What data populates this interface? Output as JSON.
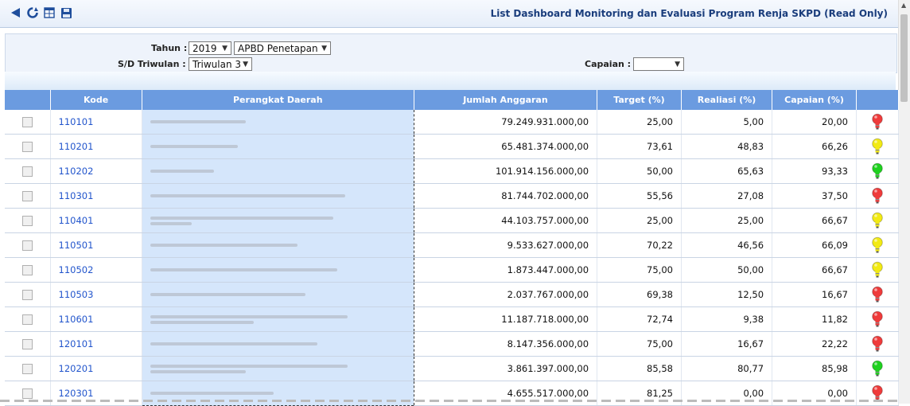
{
  "header": {
    "title": "List Dashboard Monitoring dan Evaluasi Program Renja SKPD (Read Only)"
  },
  "toolbar": {
    "icons": [
      "back-icon",
      "refresh-icon",
      "grid-icon",
      "save-icon"
    ]
  },
  "filters": {
    "tahun_label": "Tahun :",
    "tahun_value": "2019",
    "anggaran_value": "APBD Penetapan",
    "triwulan_label": "S/D Triwulan :",
    "triwulan_value": "Triwulan 3",
    "capaian_label": "Capaian :",
    "capaian_value": ""
  },
  "table": {
    "columns": [
      "",
      "Kode",
      "Perangkat Daerah",
      "Jumlah Anggaran",
      "Target (%)",
      "Realiasi (%)",
      "Capaian (%)",
      ""
    ],
    "rows": [
      {
        "kode": "110101",
        "anggaran": "79.249.931.000,00",
        "target": "25,00",
        "realisasi": "5,00",
        "capaian": "20,00",
        "status": "red",
        "blur": [
          120
        ]
      },
      {
        "kode": "110201",
        "anggaran": "65.481.374.000,00",
        "target": "73,61",
        "realisasi": "48,83",
        "capaian": "66,26",
        "status": "yellow",
        "blur": [
          110
        ]
      },
      {
        "kode": "110202",
        "anggaran": "101.914.156.000,00",
        "target": "50,00",
        "realisasi": "65,63",
        "capaian": "93,33",
        "status": "green",
        "blur": [
          80
        ]
      },
      {
        "kode": "110301",
        "anggaran": "81.744.702.000,00",
        "target": "55,56",
        "realisasi": "27,08",
        "capaian": "37,50",
        "status": "red",
        "blur": [
          245
        ]
      },
      {
        "kode": "110401",
        "anggaran": "44.103.757.000,00",
        "target": "25,00",
        "realisasi": "25,00",
        "capaian": "66,67",
        "status": "yellow",
        "blur": [
          230,
          52
        ]
      },
      {
        "kode": "110501",
        "anggaran": "9.533.627.000,00",
        "target": "70,22",
        "realisasi": "46,56",
        "capaian": "66,09",
        "status": "yellow",
        "blur": [
          185
        ]
      },
      {
        "kode": "110502",
        "anggaran": "1.873.447.000,00",
        "target": "75,00",
        "realisasi": "50,00",
        "capaian": "66,67",
        "status": "yellow",
        "blur": [
          235
        ]
      },
      {
        "kode": "110503",
        "anggaran": "2.037.767.000,00",
        "target": "69,38",
        "realisasi": "12,50",
        "capaian": "16,67",
        "status": "red",
        "blur": [
          195
        ]
      },
      {
        "kode": "110601",
        "anggaran": "11.187.718.000,00",
        "target": "72,74",
        "realisasi": "9,38",
        "capaian": "11,82",
        "status": "red",
        "blur": [
          248,
          130
        ]
      },
      {
        "kode": "120101",
        "anggaran": "8.147.356.000,00",
        "target": "75,00",
        "realisasi": "16,67",
        "capaian": "22,22",
        "status": "red",
        "blur": [
          210
        ]
      },
      {
        "kode": "120201",
        "anggaran": "3.861.397.000,00",
        "target": "85,58",
        "realisasi": "80,77",
        "capaian": "85,98",
        "status": "green",
        "blur": [
          248,
          120
        ]
      },
      {
        "kode": "120301",
        "anggaran": "4.655.517.000,00",
        "target": "81,25",
        "realisasi": "0,00",
        "capaian": "0,00",
        "status": "red",
        "blur": [
          155
        ]
      }
    ]
  },
  "colors": {
    "red": "#ef3b3b",
    "yellow": "#f2ea14",
    "green": "#1fd11f",
    "header": "#6b9be0",
    "highlight": "#d5e6fb"
  }
}
